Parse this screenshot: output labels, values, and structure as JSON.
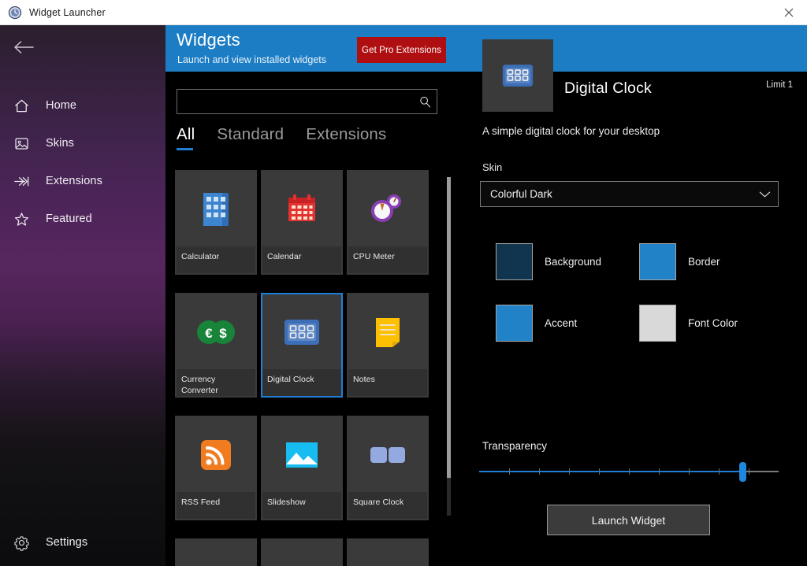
{
  "window": {
    "title": "Widget Launcher",
    "app_icon": "clock-icon",
    "close_label": "✕"
  },
  "sidebar": {
    "back_icon": "back-arrow-icon",
    "items": [
      {
        "label": "Home",
        "icon": "home-icon"
      },
      {
        "label": "Skins",
        "icon": "image-icon"
      },
      {
        "label": "Extensions",
        "icon": "fast-forward-icon"
      },
      {
        "label": "Featured",
        "icon": "star-icon"
      }
    ],
    "settings": {
      "label": "Settings",
      "icon": "gear-icon"
    }
  },
  "header": {
    "title": "Widgets",
    "subtitle": "Launch and view installed widgets",
    "pro_button": "Get Pro Extensions",
    "band_color": "#1d7dc4",
    "pro_button_color": "#b00f11"
  },
  "browser": {
    "search": {
      "value": "",
      "placeholder": "",
      "icon": "search-icon"
    },
    "tabs": [
      {
        "label": "All",
        "active": true
      },
      {
        "label": "Standard",
        "active": false
      },
      {
        "label": "Extensions",
        "active": false
      }
    ],
    "accent_color": "#1f7fd4",
    "widgets": [
      {
        "name": "Calculator",
        "icon": "calculator-icon",
        "selected": false
      },
      {
        "name": "Calendar",
        "icon": "calendar-icon",
        "selected": false
      },
      {
        "name": "CPU Meter",
        "icon": "cpu-meter-icon",
        "selected": false
      },
      {
        "name": "Currency Converter",
        "icon": "currency-converter-icon",
        "selected": false
      },
      {
        "name": "Digital Clock",
        "icon": "digital-clock-icon",
        "selected": true
      },
      {
        "name": "Notes",
        "icon": "notes-icon",
        "selected": false
      },
      {
        "name": "RSS Feed",
        "icon": "rss-feed-icon",
        "selected": false
      },
      {
        "name": "Slideshow",
        "icon": "slideshow-icon",
        "selected": false
      },
      {
        "name": "Square Clock",
        "icon": "square-clock-icon",
        "selected": false
      }
    ]
  },
  "detail": {
    "icon": "digital-clock-icon",
    "title": "Digital Clock",
    "limit": "Limit 1",
    "description": "A simple digital clock for your desktop",
    "skin_label": "Skin",
    "skin_value": "Colorful Dark",
    "skin_chevron": "chevron-down-icon",
    "colors": [
      {
        "label": "Background",
        "hex": "#12354f"
      },
      {
        "label": "Border",
        "hex": "#1f73ad"
      },
      {
        "label": "Accent",
        "hex": "#2182c8"
      },
      {
        "label": "Font Color",
        "hex": "#d9d9d9"
      }
    ],
    "transparency_label": "Transparency",
    "transparency_value": 88,
    "launch_button": "Launch Widget"
  }
}
